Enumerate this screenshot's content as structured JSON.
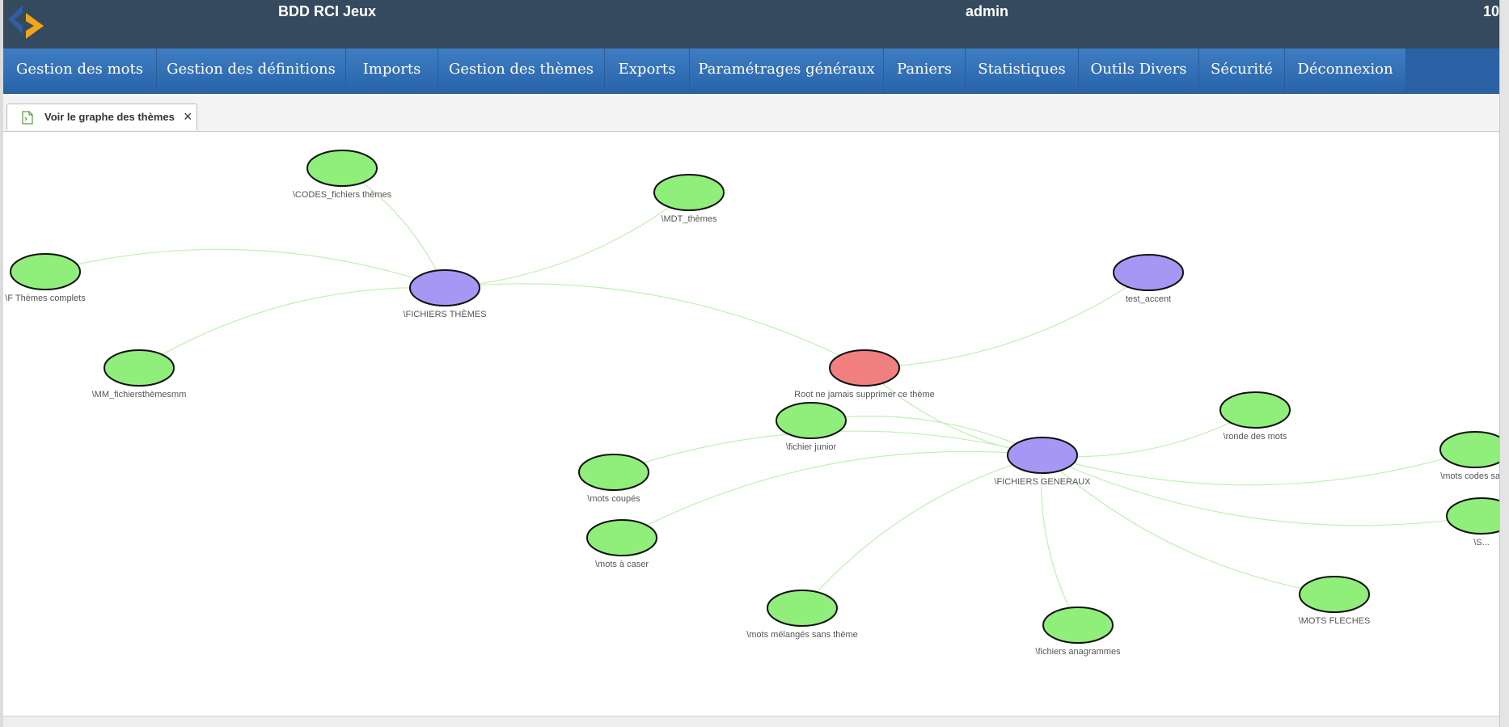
{
  "header": {
    "app_title": "BDD RCI Jeux",
    "user": "admin",
    "right_text": "10"
  },
  "nav": {
    "items": [
      {
        "label": "Gestion des mots"
      },
      {
        "label": "Gestion des définitions"
      },
      {
        "label": "Imports"
      },
      {
        "label": "Gestion des thèmes"
      },
      {
        "label": "Exports"
      },
      {
        "label": "Paramétrages généraux"
      },
      {
        "label": "Paniers"
      },
      {
        "label": "Statistiques"
      },
      {
        "label": "Outils Divers"
      },
      {
        "label": "Sécurité"
      },
      {
        "label": "Déconnexion"
      }
    ]
  },
  "tab": {
    "label": "Voir le graphe des thèmes",
    "close": "×"
  },
  "graph": {
    "colors": {
      "root": "#f08080",
      "group": "#a797f5",
      "leaf": "#90ee7a",
      "edge": "#bff0b2"
    },
    "nodes": [
      {
        "id": "root",
        "label": "Root ne jamais supprimer ce thème",
        "kind": "root"
      },
      {
        "id": "ft",
        "label": "\\FICHIERS THÈMES",
        "kind": "group"
      },
      {
        "id": "ta",
        "label": "test_accent",
        "kind": "group"
      },
      {
        "id": "fg",
        "label": "\\FICHIERS GENERAUX",
        "kind": "group"
      },
      {
        "id": "codes",
        "label": "\\CODES_fichiers thèmes",
        "kind": "leaf"
      },
      {
        "id": "mdt",
        "label": "\\MDT_thèmes",
        "kind": "leaf"
      },
      {
        "id": "ftc",
        "label": "\\F Thèmes complets",
        "kind": "leaf"
      },
      {
        "id": "mm",
        "label": "\\MM_fichiersthèmesmm",
        "kind": "leaf"
      },
      {
        "id": "junior",
        "label": "\\fichier junior",
        "kind": "leaf"
      },
      {
        "id": "coupes",
        "label": "\\mots coupés",
        "kind": "leaf"
      },
      {
        "id": "caser",
        "label": "\\mots à caser",
        "kind": "leaf"
      },
      {
        "id": "melanges",
        "label": "\\mots mélangés sans thème",
        "kind": "leaf"
      },
      {
        "id": "anag",
        "label": "\\fichiers anagrammes",
        "kind": "leaf"
      },
      {
        "id": "fleches",
        "label": "\\MOTS FLECHES",
        "kind": "leaf"
      },
      {
        "id": "ronde",
        "label": "\\ronde des mots",
        "kind": "leaf"
      },
      {
        "id": "codesans",
        "label": "\\mots codes sans",
        "kind": "leaf"
      },
      {
        "id": "s",
        "label": "\\S...",
        "kind": "leaf"
      }
    ],
    "edges": [
      [
        "root",
        "ft"
      ],
      [
        "root",
        "ta"
      ],
      [
        "root",
        "fg"
      ],
      [
        "ft",
        "codes"
      ],
      [
        "ft",
        "mdt"
      ],
      [
        "ft",
        "ftc"
      ],
      [
        "ft",
        "mm"
      ],
      [
        "fg",
        "junior"
      ],
      [
        "fg",
        "coupes"
      ],
      [
        "fg",
        "caser"
      ],
      [
        "fg",
        "melanges"
      ],
      [
        "fg",
        "anag"
      ],
      [
        "fg",
        "fleches"
      ],
      [
        "fg",
        "ronde"
      ],
      [
        "fg",
        "codesans"
      ],
      [
        "fg",
        "s"
      ]
    ]
  }
}
